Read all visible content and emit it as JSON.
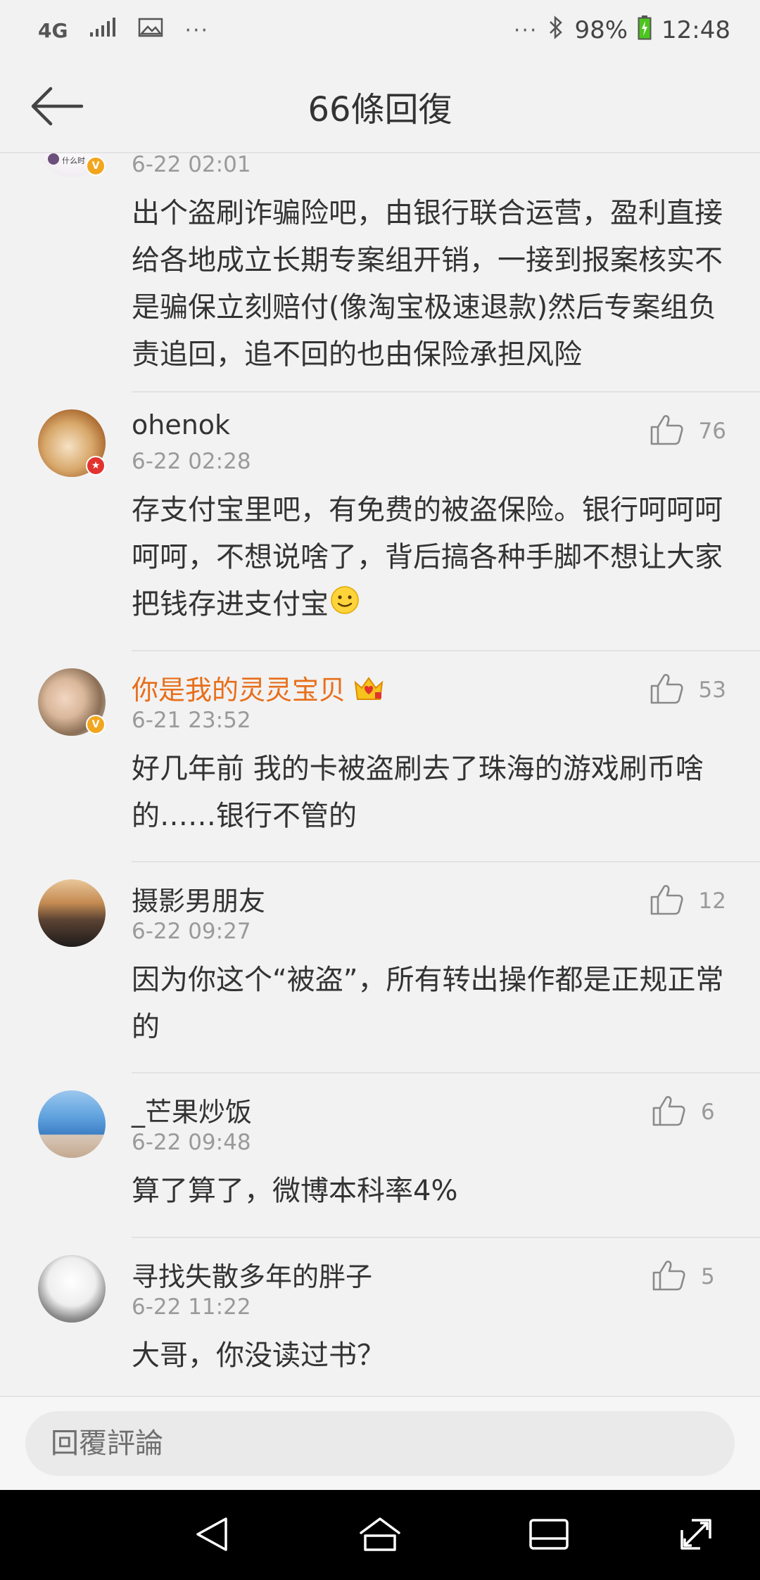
{
  "status_bar": {
    "network": "4G",
    "battery": "98%",
    "time": "12:48",
    "more": "···",
    "icons": [
      "signal-icon",
      "image-icon",
      "bluetooth-icon",
      "battery-icon"
    ]
  },
  "header": {
    "title": "66條回復",
    "back_icon": "arrow-left-icon"
  },
  "comments": [
    {
      "avatar_caption": "什么时",
      "badge": "V",
      "time": "6-22 02:01",
      "text": "出个盗刷诈骗险吧，由银行联合运营，盈利直接给各地成立长期专案组开销，一接到报案核实不是骗保立刻赔付(像淘宝极速退款)然后专案组负责追回，追不回的也由保险承担风险"
    },
    {
      "name": "ohenok",
      "badge": "★",
      "time": "6-22 02:28",
      "likes": "76",
      "text": "存支付宝里吧，有免费的被盗保险。银行呵呵呵呵呵，不想说啥了，背后搞各种手脚不想让大家把钱存进支付宝",
      "emoji": "smile-emoji-icon"
    },
    {
      "name": "你是我的灵灵宝贝",
      "badge": "V",
      "time": "6-21 23:52",
      "likes": "53",
      "text": "好几年前 我的卡被盗刷去了珠海的游戏刷币啥的……银行不管的"
    },
    {
      "name": "摄影男朋友",
      "time": "6-22 09:27",
      "likes": "12",
      "text": "因为你这个“被盗”，所有转出操作都是正规正常的"
    },
    {
      "name": "_芒果炒饭",
      "time": "6-22 09:48",
      "likes": "6",
      "text": "算了算了，微博本科率4%"
    },
    {
      "name": "寻找失散多年的胖子",
      "time": "6-22 11:22",
      "likes": "5",
      "text": "大哥，你没读过书？"
    }
  ],
  "reply": {
    "placeholder": "回覆評論"
  },
  "nav": [
    "nav-back-icon",
    "nav-home-icon",
    "nav-recents-icon",
    "nav-expand-icon"
  ],
  "colors": {
    "background": "#f2f2f2",
    "vip_name": "#e86e1a",
    "badge_v": "#f2a61f",
    "badge_star": "#e2332f",
    "meta_gray": "#9a9a9a"
  }
}
